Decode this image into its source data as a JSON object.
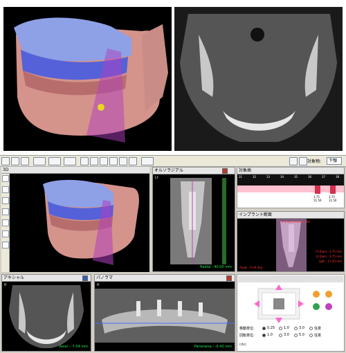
{
  "toolbar": {
    "target_label": "対象物:",
    "target_value": "下顎"
  },
  "panels": {
    "view3d": {
      "title": "3D"
    },
    "ortho": {
      "title": "オルソラジアル",
      "caption": "Radial : 40.00 mm",
      "corner": "Lt"
    },
    "target_teeth": {
      "title": "対象歯",
      "teeth": [
        "31",
        "32",
        "33",
        "34",
        "35",
        "36",
        "37",
        "38"
      ],
      "vals1": "3.75",
      "vals2": "11.50",
      "vals3": "3.75",
      "vals4": "11.50"
    },
    "implant": {
      "title": "インプラント断面",
      "label_top": "Implant Plexxxx - 66",
      "cap_left": "Angle : 0.00 deg",
      "cap_r1": "Ct:Diam : 3.75 mm",
      "cap_r2": "Lt:Diam : 3.75 mm",
      "cap_r3": "Lgth : 11.50 mm"
    },
    "axial": {
      "title": "アキシャル",
      "caption": "Axial : -7.54 mm",
      "corner": "R"
    },
    "panorama": {
      "title": "パノラマ",
      "caption": "Panorama : -0.42 mm",
      "corner": "R"
    }
  },
  "controls": {
    "move_label": "移動単位:",
    "move_opts": [
      "0.25",
      "1.0",
      "3.0",
      "任意"
    ],
    "rot_label": "回転単位:",
    "rot_opts": [
      "1.0",
      "3.0",
      "5.0",
      "任意"
    ],
    "status": "(dx)"
  },
  "colors": {
    "teeth_blue": "#5561d8",
    "gum": "#d99a95",
    "bone": "#d6a0a0",
    "plane": "#b040c0",
    "accent_pink": "#ff66cc",
    "caption_green": "#22ee55",
    "caption_red": "#ff3333"
  }
}
